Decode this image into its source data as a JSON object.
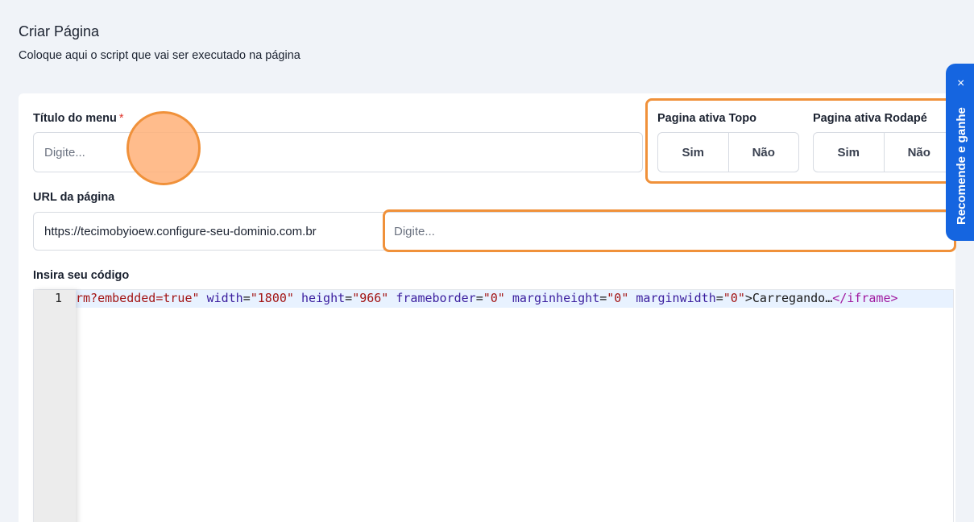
{
  "header": {
    "title": "Criar Página",
    "subtitle": "Coloque aqui o script que vai ser executado na página"
  },
  "form": {
    "menu_title": {
      "label": "Título do menu",
      "required_mark": "*",
      "placeholder": "Digite..."
    },
    "active_top": {
      "label": "Pagina ativa Topo",
      "yes": "Sim",
      "no": "Não"
    },
    "active_footer": {
      "label": "Pagina ativa Rodapé",
      "yes": "Sim",
      "no": "Não"
    },
    "url": {
      "label": "URL da página",
      "prefix": "https://tecimobyioew.configure-seu-dominio.com.br",
      "placeholder": "Digite..."
    },
    "code": {
      "label": "Insira seu código",
      "line_number": "1",
      "tokens": [
        {
          "text": "rm?embedded=true\"",
          "type": "string"
        },
        {
          "text": " ",
          "type": "plain"
        },
        {
          "text": "width",
          "type": "attr"
        },
        {
          "text": "=",
          "type": "plain"
        },
        {
          "text": "\"1800\"",
          "type": "string"
        },
        {
          "text": " ",
          "type": "plain"
        },
        {
          "text": "height",
          "type": "attr"
        },
        {
          "text": "=",
          "type": "plain"
        },
        {
          "text": "\"966\"",
          "type": "string"
        },
        {
          "text": " ",
          "type": "plain"
        },
        {
          "text": "frameborder",
          "type": "attr"
        },
        {
          "text": "=",
          "type": "plain"
        },
        {
          "text": "\"0\"",
          "type": "string"
        },
        {
          "text": " ",
          "type": "plain"
        },
        {
          "text": "marginheight",
          "type": "attr"
        },
        {
          "text": "=",
          "type": "plain"
        },
        {
          "text": "\"0\"",
          "type": "string"
        },
        {
          "text": " ",
          "type": "plain"
        },
        {
          "text": "marginwidth",
          "type": "attr"
        },
        {
          "text": "=",
          "type": "plain"
        },
        {
          "text": "\"0\"",
          "type": "string"
        },
        {
          "text": ">Carregando…",
          "type": "plain"
        },
        {
          "text": "</iframe>",
          "type": "tag"
        }
      ]
    }
  },
  "side_tab": {
    "label": "Recomende e ganhe",
    "close_icon": "×"
  },
  "colors": {
    "highlight": "#f0913a",
    "side_tab": "#1565e0",
    "required": "#e0342b"
  }
}
